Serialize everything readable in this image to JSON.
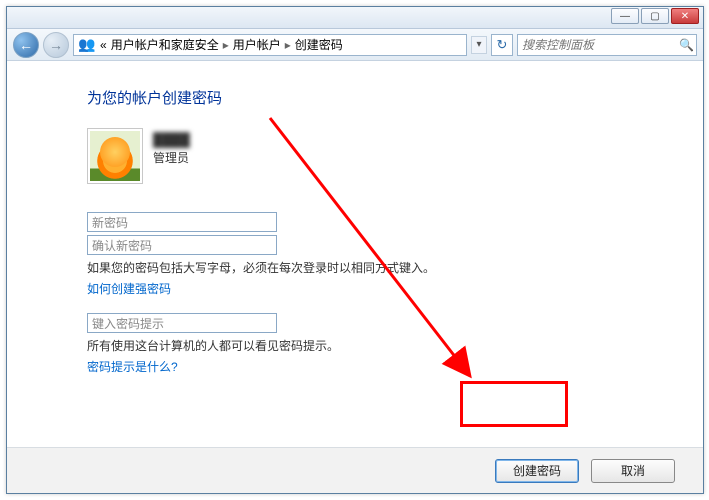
{
  "titlebar": {
    "min": "—",
    "max": "▢",
    "close": "✕"
  },
  "nav": {
    "back_glyph": "←",
    "forward_glyph": "→",
    "refresh_glyph": "↻",
    "crumb_glyph": "«",
    "crumbs": [
      "用户帐户和家庭安全",
      "用户帐户",
      "创建密码"
    ],
    "sep": "▸"
  },
  "search": {
    "placeholder": "搜索控制面板",
    "icon": "🔍"
  },
  "page": {
    "heading": "为您的帐户创建密码",
    "user_name": "████",
    "user_role": "管理员",
    "new_password_placeholder": "新密码",
    "confirm_password_placeholder": "确认新密码",
    "caps_note": "如果您的密码包括大写字母，必须在每次登录时以相同方式键入。",
    "strong_link": "如何创建强密码",
    "hint_placeholder": "键入密码提示",
    "hint_note": "所有使用这台计算机的人都可以看见密码提示。",
    "hint_link": "密码提示是什么?"
  },
  "footer": {
    "primary": "创建密码",
    "cancel": "取消"
  }
}
